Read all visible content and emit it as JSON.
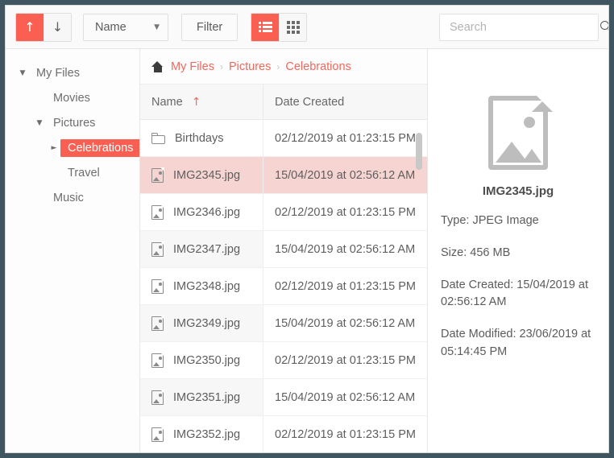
{
  "toolbar": {
    "sort_asc_icon": "arrow-up-icon",
    "sort_asc_glyph": "↑",
    "sort_desc_icon": "arrow-down-icon",
    "sort_desc_glyph": "↓",
    "sort_field_label": "Name",
    "sort_caret_glyph": "▼",
    "filter_label": "Filter",
    "view_list_icon": "list-view-icon",
    "view_grid_icon": "grid-view-icon",
    "active_view": "list",
    "accent_color": "#fa5f52"
  },
  "search": {
    "value": "",
    "placeholder": "Search",
    "icon": "search-icon"
  },
  "sidebar": {
    "items": [
      {
        "label": "My Files",
        "level": 0,
        "twisty": "▼",
        "selected": false
      },
      {
        "label": "Movies",
        "level": 1,
        "twisty": "",
        "selected": false
      },
      {
        "label": "Pictures",
        "level": 1,
        "twisty": "▼",
        "selected": false
      },
      {
        "label": "Celebrations",
        "level": 2,
        "twisty": "►",
        "selected": true
      },
      {
        "label": "Travel",
        "level": 2,
        "twisty": "",
        "selected": false
      },
      {
        "label": "Music",
        "level": 1,
        "twisty": "",
        "selected": false
      }
    ]
  },
  "breadcrumb": {
    "home_icon": "home-icon",
    "separator": "›",
    "crumbs": [
      "My Files",
      "Pictures",
      "Celebrations"
    ]
  },
  "file_table": {
    "columns": [
      {
        "label": "Name",
        "sorted": true,
        "sort_glyph": "↑"
      },
      {
        "label": "Date Created",
        "sorted": false,
        "sort_glyph": ""
      }
    ],
    "rows": [
      {
        "name": "Birthdays",
        "date": "02/12/2019 at 01:23:15 PM",
        "icon": "folder-icon",
        "selected": false,
        "zebra": false
      },
      {
        "name": "IMG2345.jpg",
        "date": "15/04/2019 at 02:56:12 AM",
        "icon": "image-file-icon",
        "selected": true,
        "zebra": false
      },
      {
        "name": "IMG2346.jpg",
        "date": "02/12/2019 at 01:23:15 PM",
        "icon": "image-file-icon",
        "selected": false,
        "zebra": false
      },
      {
        "name": "IMG2347.jpg",
        "date": "15/04/2019 at 02:56:12 AM",
        "icon": "image-file-icon",
        "selected": false,
        "zebra": true
      },
      {
        "name": "IMG2348.jpg",
        "date": "02/12/2019 at 01:23:15 PM",
        "icon": "image-file-icon",
        "selected": false,
        "zebra": false
      },
      {
        "name": "IMG2349.jpg",
        "date": "15/04/2019 at 02:56:12 AM",
        "icon": "image-file-icon",
        "selected": false,
        "zebra": true
      },
      {
        "name": "IMG2350.jpg",
        "date": "02/12/2019 at 01:23:15 PM",
        "icon": "image-file-icon",
        "selected": false,
        "zebra": false
      },
      {
        "name": "IMG2351.jpg",
        "date": "15/04/2019 at 02:56:12 AM",
        "icon": "image-file-icon",
        "selected": false,
        "zebra": true
      },
      {
        "name": "IMG2352.jpg",
        "date": "02/12/2019 at 01:23:15 PM",
        "icon": "image-file-icon",
        "selected": false,
        "zebra": false
      }
    ]
  },
  "detail_panel": {
    "preview_icon": "image-file-large-icon",
    "filename": "IMG2345.jpg",
    "type_line": "Type: JPEG Image",
    "size_line": "Size: 456 MB",
    "date_created_line": "Date Created: 15/04/2019 at 02:56:12 AM",
    "date_modified_line": "Date Modified: 23/06/2019 at 05:14:45 PM"
  }
}
